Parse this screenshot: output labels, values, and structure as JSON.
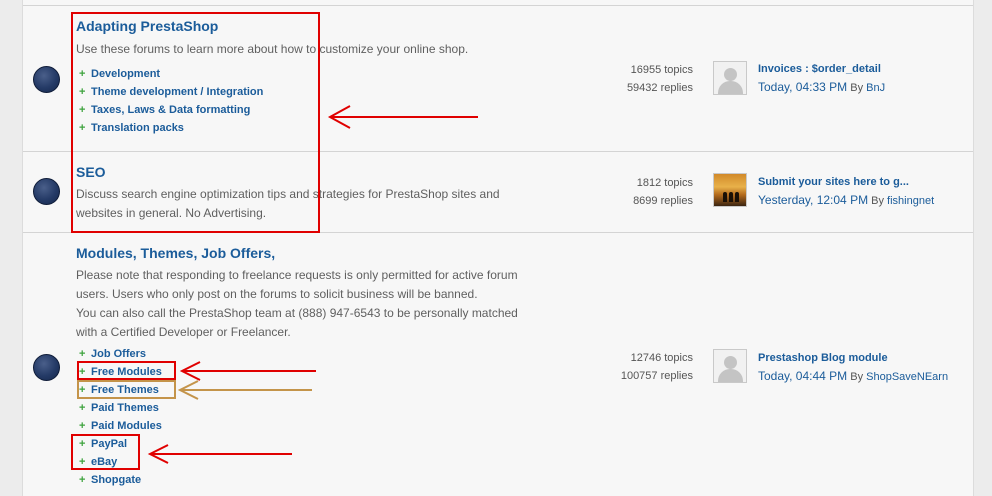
{
  "forums": [
    {
      "title": "Adapting PrestaShop",
      "description": [
        "Use these forums to learn more about how to customize your online shop."
      ],
      "subforums": [
        "Development",
        "Theme development / Integration",
        "Taxes, Laws & Data formatting",
        "Translation packs"
      ],
      "topics": "16955 topics",
      "replies": "59432 replies",
      "last_post": {
        "title": "Invoices : $order_detail",
        "date": "Today, 04:33 PM",
        "by": "By",
        "author": "BnJ"
      }
    },
    {
      "title": "SEO",
      "description": [
        "Discuss search engine optimization tips and strategies for PrestaShop sites and",
        "websites in general. No Advertising."
      ],
      "subforums": [],
      "topics": "1812 topics",
      "replies": "8699 replies",
      "last_post": {
        "title": "Submit your sites here to g...",
        "date": "Yesterday, 12:04 PM",
        "by": "By",
        "author": "fishingnet"
      }
    },
    {
      "title": "Modules, Themes, Job Offers,",
      "description": [
        "Please note that responding to freelance requests is only permitted for active forum",
        "users. Users who only post on the forums to solicit business will be banned.",
        "You can also call the PrestaShop team at (888) 947-6543 to be personally matched",
        "with a Certified Developer or Freelancer."
      ],
      "subforums": [
        "Job Offers",
        "Free Modules",
        "Free Themes",
        "Paid Themes",
        "Paid Modules",
        "PayPal",
        "eBay",
        "Shopgate"
      ],
      "topics": "12746 topics",
      "replies": "100757 replies",
      "last_post": {
        "title": "Prestashop Blog module",
        "date": "Today, 04:44 PM",
        "by": "By",
        "author": "ShopSaveNEarn"
      }
    }
  ],
  "icons": {
    "plus": "+",
    "avatar_default": "default-avatar-icon",
    "avatar_photo": "sunset-photo-avatar"
  },
  "colors": {
    "link": "#1b5c9a",
    "annotation_red": "#e00000",
    "annotation_gold": "#c4944a",
    "plus_green": "#3da33d"
  }
}
